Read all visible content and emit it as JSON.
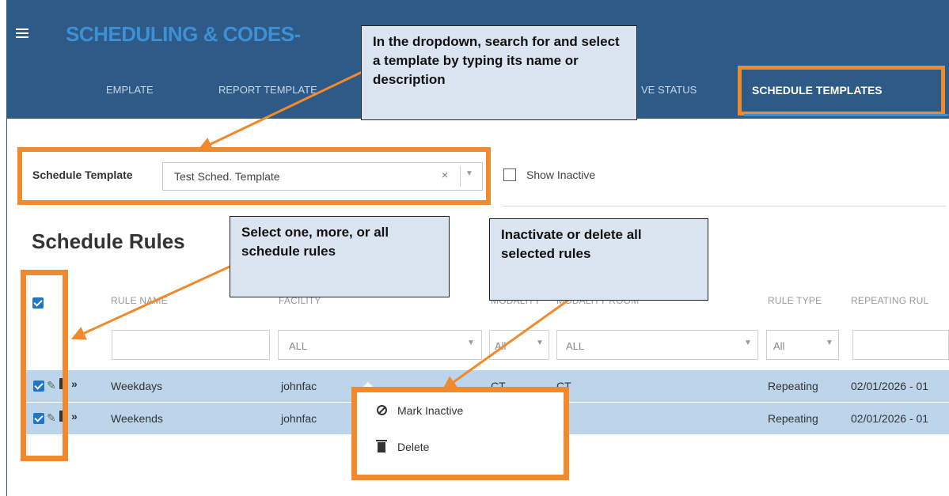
{
  "header": {
    "app_title": "SCHEDULING & CODES",
    "app_title_suffix": "-",
    "tabs": [
      {
        "label": "EMPLATE"
      },
      {
        "label": "REPORT TEMPLATE"
      },
      {
        "label": "VE STATUS"
      }
    ],
    "active_tab": "SCHEDULE TEMPLATES"
  },
  "template_filter": {
    "label": "Schedule Template",
    "value": "Test Sched. Template",
    "clear_glyph": "×",
    "show_inactive_label": "Show Inactive",
    "show_inactive_checked": false
  },
  "section": {
    "title": "Schedule Rules"
  },
  "table": {
    "columns": {
      "rule_name": "RULE NAME",
      "facility": "FACILITY",
      "modality": "MODALITY",
      "modality_room": "MODALITY ROOM",
      "rule_type": "RULE TYPE",
      "repeating_rule": "REPEATING RUL"
    },
    "filters": {
      "facility": "ALL",
      "modality": "All",
      "modality_room": "ALL",
      "rule_type": "All"
    },
    "rows": [
      {
        "rule_name": "Weekdays",
        "facility": "johnfac",
        "modality": "CT",
        "modality_room": "CT",
        "rule_type": "Repeating",
        "repeating_rule": "02/01/2026 - 01",
        "selected": true
      },
      {
        "rule_name": "Weekends",
        "facility": "johnfac",
        "modality": "",
        "modality_room": "",
        "rule_type": "Repeating",
        "repeating_rule": "02/01/2026 - 01",
        "selected": true
      }
    ]
  },
  "context_menu": {
    "mark_inactive": "Mark Inactive",
    "delete": "Delete"
  },
  "callouts": {
    "dropdown_hint": "In the dropdown, search for and select a template by typing its name or description",
    "select_hint": "Select one, more, or all schedule rules",
    "action_hint": "Inactivate or delete all selected rules"
  },
  "colors": {
    "header_bg": "#2d5a86",
    "highlight": "#f08a2c",
    "row_selected": "#bcd5ea",
    "callout_bg": "#dbe4f1",
    "checkbox": "#1f76c6"
  }
}
